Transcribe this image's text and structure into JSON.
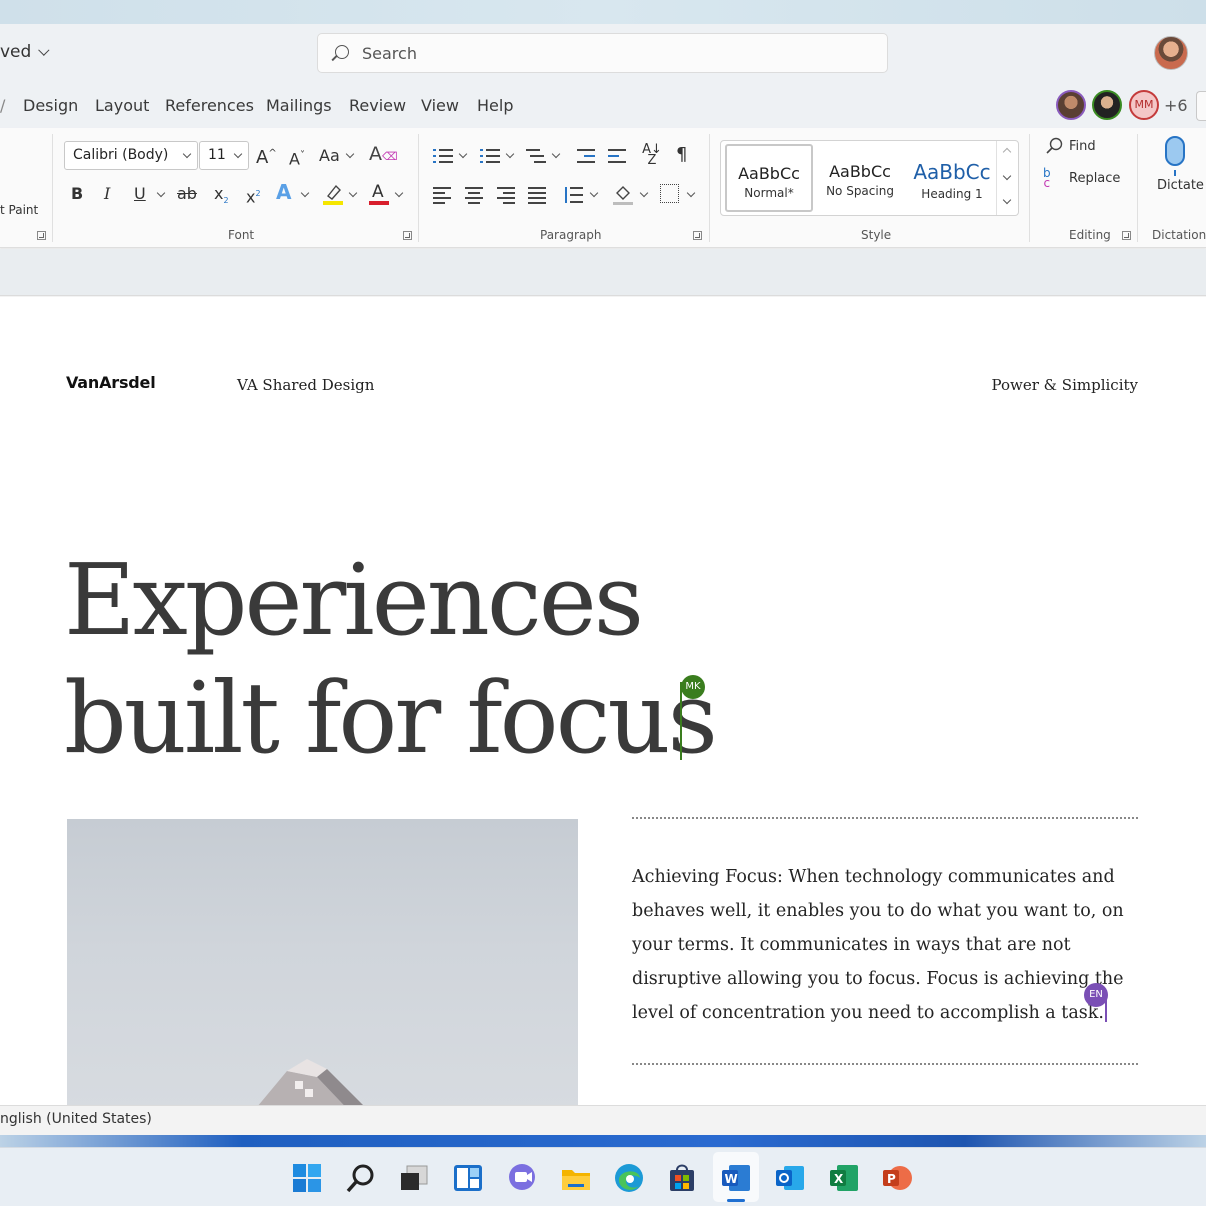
{
  "titlebar": {
    "saved_label": "ved",
    "search_placeholder": "Search"
  },
  "tabs": [
    "Design",
    "Layout",
    "References",
    "Mailings",
    "Review",
    "View",
    "Help"
  ],
  "collaborators": {
    "mm_initials": "MM",
    "more_count": "+6"
  },
  "ribbon": {
    "clipboard": {
      "paint_label": "t Paint"
    },
    "font": {
      "family": "Calibri (Body)",
      "size": "11",
      "grow": "A^",
      "shrink": "A˅",
      "change_case": "Aa",
      "bold": "B",
      "italic": "I",
      "underline": "U",
      "strike": "ab",
      "subscript": "x",
      "superscript": "x",
      "group_label": "Font"
    },
    "paragraph": {
      "group_label": "Paragraph"
    },
    "styles": {
      "items": [
        {
          "preview": "AaBbCc",
          "name": "Normal*"
        },
        {
          "preview": "AaBbCc",
          "name": "No Spacing"
        },
        {
          "preview": "AaBbCc",
          "name": "Heading 1"
        }
      ],
      "group_label": "Style"
    },
    "editing": {
      "find": "Find",
      "replace": "Replace",
      "group_label": "Editing"
    },
    "dictation": {
      "dictate": "Dictate",
      "group_label": "Dictation"
    }
  },
  "document": {
    "logo": "VanArsdel",
    "header_center": "VA Shared Design",
    "header_right": "Power & Simplicity",
    "headline_line1": "Experiences",
    "headline_line2": "built for focus",
    "cursor_mk": "MK",
    "cursor_en": "EN",
    "body": "Achieving Focus: When technology communicates and behaves well, it enables you to do what you want to, on your terms. It communicates in ways that are not disruptive allowing you to focus. Focus is achieving the level of concentration you need to accomplish a task."
  },
  "statusbar": {
    "language": "nglish (United States)"
  },
  "taskbar": {
    "apps": [
      "start-icon",
      "search-icon",
      "task-view-icon",
      "widgets-icon",
      "teams-chat-icon",
      "file-explorer-icon",
      "edge-icon",
      "store-icon",
      "word-icon",
      "outlook-icon",
      "excel-icon",
      "powerpoint-icon"
    ]
  }
}
